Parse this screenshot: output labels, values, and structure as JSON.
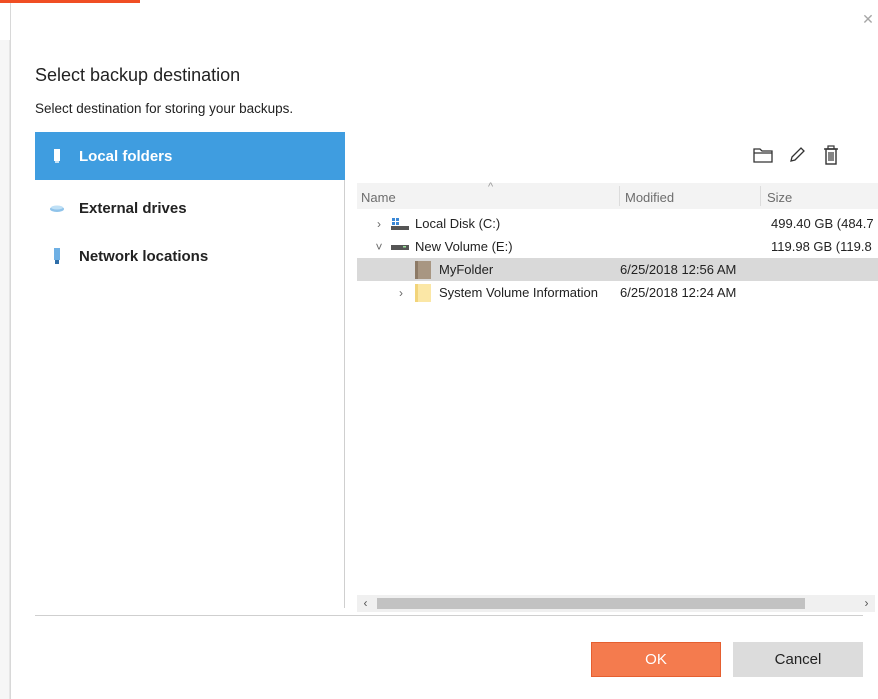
{
  "dialog": {
    "title": "Select backup destination",
    "subtitle": "Select destination for storing your backups.",
    "close_icon": "close-icon"
  },
  "sidebar": {
    "items": [
      {
        "label": "Local folders",
        "icon": "local-folder-icon",
        "active": true
      },
      {
        "label": "External drives",
        "icon": "external-drive-icon",
        "active": false
      },
      {
        "label": "Network locations",
        "icon": "network-location-icon",
        "active": false
      }
    ]
  },
  "toolbar": {
    "buttons": [
      {
        "name": "new-folder",
        "icon": "folder-icon"
      },
      {
        "name": "rename",
        "icon": "pencil-icon"
      },
      {
        "name": "delete",
        "icon": "trash-icon"
      }
    ]
  },
  "grid": {
    "columns": {
      "name": "Name",
      "modified": "Modified",
      "size": "Size"
    },
    "rows": [
      {
        "name": "Local Disk (C:)",
        "modified": "",
        "size": "499.40 GB (484.7",
        "expanded": false,
        "level": 0,
        "icon": "system-drive-icon"
      },
      {
        "name": "New Volume (E:)",
        "modified": "",
        "size": "119.98 GB (119.8",
        "expanded": true,
        "level": 0,
        "icon": "drive-icon"
      },
      {
        "name": "MyFolder",
        "modified": "6/25/2018 12:56 AM",
        "size": "",
        "selected": true,
        "level": 1,
        "icon": "folder-icon"
      },
      {
        "name": "System Volume Information",
        "modified": "6/25/2018 12:24 AM",
        "size": "",
        "expanded": false,
        "level": 1,
        "icon": "folder-icon"
      }
    ]
  },
  "buttons": {
    "ok": "OK",
    "cancel": "Cancel"
  },
  "colors": {
    "accent": "#3f9de0",
    "ok": "#f47b4e"
  }
}
